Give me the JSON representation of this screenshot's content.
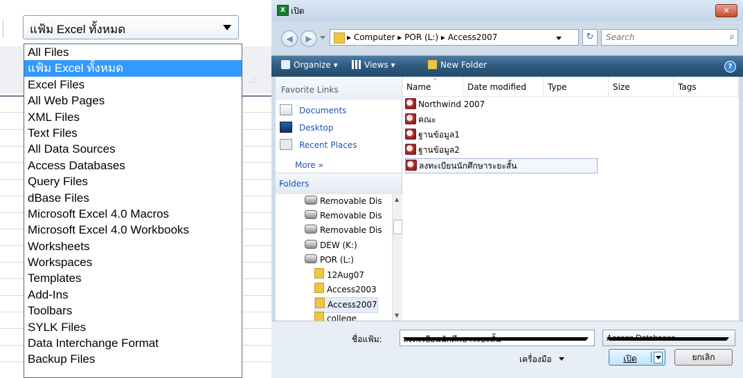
{
  "left": {
    "filter_value": "แฟ้ม Excel ทั้งหมด",
    "options": [
      "All Files",
      "แฟ้ม Excel ทั้งหมด",
      "Excel Files",
      "All Web Pages",
      "XML Files",
      "Text Files",
      "All Data Sources",
      "Access Databases",
      "Query Files",
      "dBase Files",
      "Microsoft Excel 4.0 Macros",
      "Microsoft Excel 4.0 Workbooks",
      "Worksheets",
      "Workspaces",
      "Templates",
      "Add-Ins",
      "Toolbars",
      "SYLK Files",
      "Data Interchange Format",
      "Backup Files"
    ],
    "selected_option": "แฟ้ม Excel ทั้งหมด"
  },
  "dialog": {
    "title": "เปิด",
    "close_label": "✕",
    "address": {
      "path": [
        "Computer",
        "POR (L:)",
        "Access2007"
      ],
      "crumbs_text": "▸ Computer ▸ POR (L:) ▸ Access2007"
    },
    "search_placeholder": "Search",
    "toolbar": {
      "organize": "Organize ▾",
      "views": "Views ▾",
      "new_folder": "New Folder",
      "help": "?"
    },
    "favorites": {
      "header": "Favorite Links",
      "items": [
        "Documents",
        "Desktop",
        "Recent Places"
      ],
      "more": "More »"
    },
    "folders": {
      "header": "Folders",
      "chevron": "⌄"
    },
    "tree": [
      "Removable Dis",
      "Removable Dis",
      "Removable Dis",
      "DEW (K:)",
      "POR (L:)",
      "12Aug07",
      "Access2003",
      "Access2007",
      "college"
    ],
    "columns": [
      "Name",
      "Date modified",
      "Type",
      "Size",
      "Tags"
    ],
    "files": [
      "Northwind 2007",
      "คณะ",
      "ฐานข้อมูล1",
      "ฐานข้อมูล2",
      "ลงทะเบียนนักศึกษาระยะสั้น"
    ],
    "selected_file": "ลงทะเบียนนักศึกษาระยะสั้น",
    "filename_label": "ชื่อแฟ้ม:",
    "filename_value": "ลงทะเบียนนักศึกษาระยะสั้น",
    "filetype_value": "Access Databases",
    "tools_label": "เครื่องมือ",
    "open_label": "เปิด",
    "cancel_label": "ยกเลิก"
  }
}
